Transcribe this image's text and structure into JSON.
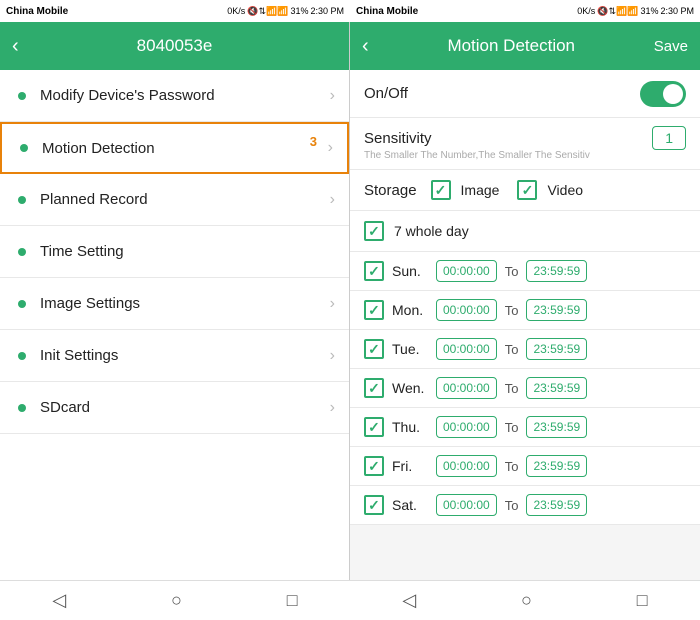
{
  "statusBar": {
    "left": {
      "carrier": "China Mobile",
      "speed": "0K/s",
      "time": "2:30 PM",
      "battery": "31%"
    },
    "right": {
      "carrier": "China Mobile",
      "speed": "0K/s",
      "time": "2:30 PM",
      "battery": "31%"
    }
  },
  "leftPanel": {
    "title": "8040053e",
    "backArrow": "‹",
    "menuItems": [
      {
        "label": "Modify Device's Password",
        "hasArrow": true,
        "badge": null,
        "highlighted": false
      },
      {
        "label": "Motion Detection",
        "hasArrow": true,
        "badge": "3",
        "highlighted": true
      },
      {
        "label": "Planned Record",
        "hasArrow": true,
        "badge": null,
        "highlighted": false
      },
      {
        "label": "Time Setting",
        "hasArrow": false,
        "badge": null,
        "highlighted": false
      },
      {
        "label": "Image Settings",
        "hasArrow": true,
        "badge": null,
        "highlighted": false
      },
      {
        "label": "Init Settings",
        "hasArrow": true,
        "badge": null,
        "highlighted": false
      },
      {
        "label": "SDcard",
        "hasArrow": true,
        "badge": null,
        "highlighted": false
      }
    ]
  },
  "rightPanel": {
    "title": "Motion Detection",
    "backArrow": "‹",
    "saveLabel": "Save",
    "onOffLabel": "On/Off",
    "sensitivityLabel": "Sensitivity",
    "sensitivitySubLabel": "The Smaller The Number,The Smaller The Sensitiv",
    "sensitivityValue": "1",
    "storageLabel": "Storage",
    "imageLabel": "Image",
    "videoLabel": "Video",
    "wholeDayLabel": "7 whole day",
    "days": [
      {
        "label": "Sun.",
        "start": "00:00:00",
        "end": "23:59:59"
      },
      {
        "label": "Mon.",
        "start": "00:00:00",
        "end": "23:59:59"
      },
      {
        "label": "Tue.",
        "start": "00:00:00",
        "end": "23:59:59"
      },
      {
        "label": "Wen.",
        "start": "00:00:00",
        "end": "23:59:59"
      },
      {
        "label": "Thu.",
        "start": "00:00:00",
        "end": "23:59:59"
      },
      {
        "label": "Fri.",
        "start": "00:00:00",
        "end": "23:59:59"
      },
      {
        "label": "Sat.",
        "start": "00:00:00",
        "end": "23:59:59"
      }
    ],
    "toLabel": "To"
  },
  "bottomNav": {
    "backIcon": "◁",
    "homeIcon": "○",
    "squareIcon": "□"
  }
}
